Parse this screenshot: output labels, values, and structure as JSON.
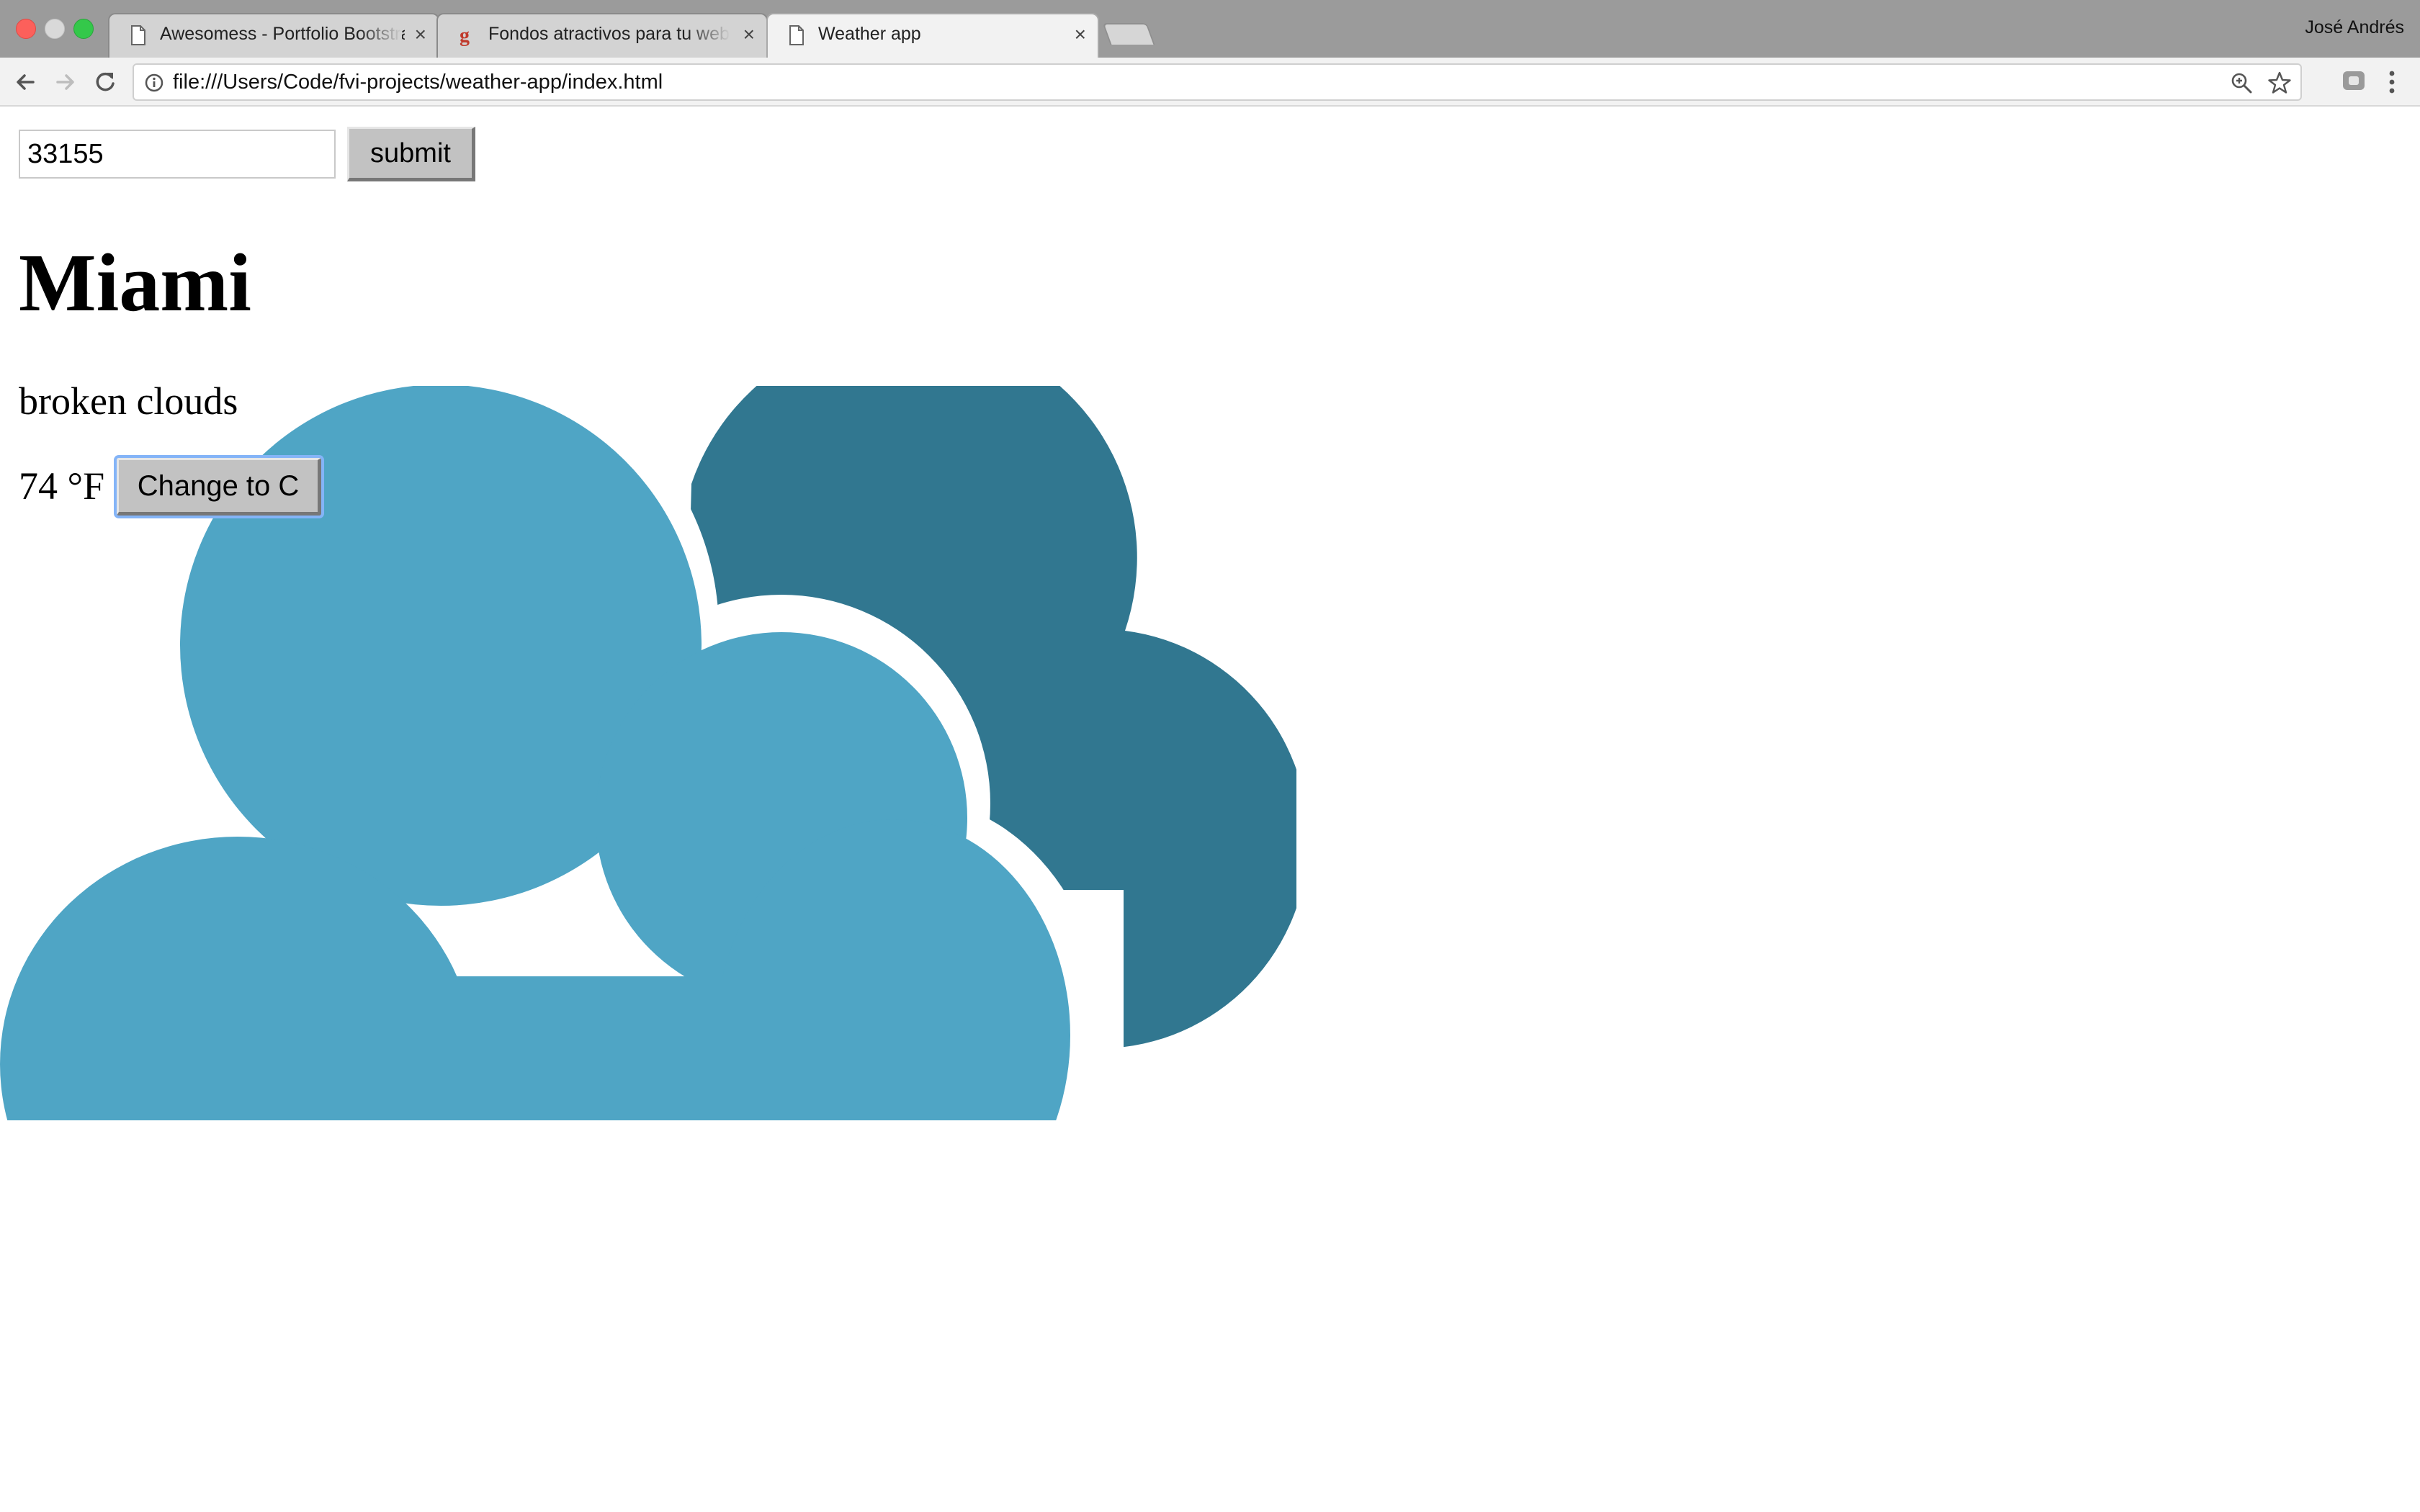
{
  "browser": {
    "tabs": [
      {
        "title": "Awesomess - Portfolio Bootstrap",
        "icon": "page-icon"
      },
      {
        "title": "Fondos atractivos para tu web",
        "icon": "google-g-icon"
      },
      {
        "title": "Weather app",
        "icon": "page-icon"
      }
    ],
    "active_tab": "Weather app",
    "close_glyph": "×",
    "profile_name": "José Andrés",
    "url": "file:///Users/Code/fvi-projects/weather-app/index.html"
  },
  "app": {
    "zip_value": "33155",
    "submit_label": "submit",
    "city": "Miami",
    "description": "broken clouds",
    "temperature": "74 °F",
    "toggle_label": "Change to C"
  },
  "colors": {
    "cloud_front": "#4fa5c5",
    "cloud_back": "#317790",
    "focus_ring": "#84b4f7"
  }
}
